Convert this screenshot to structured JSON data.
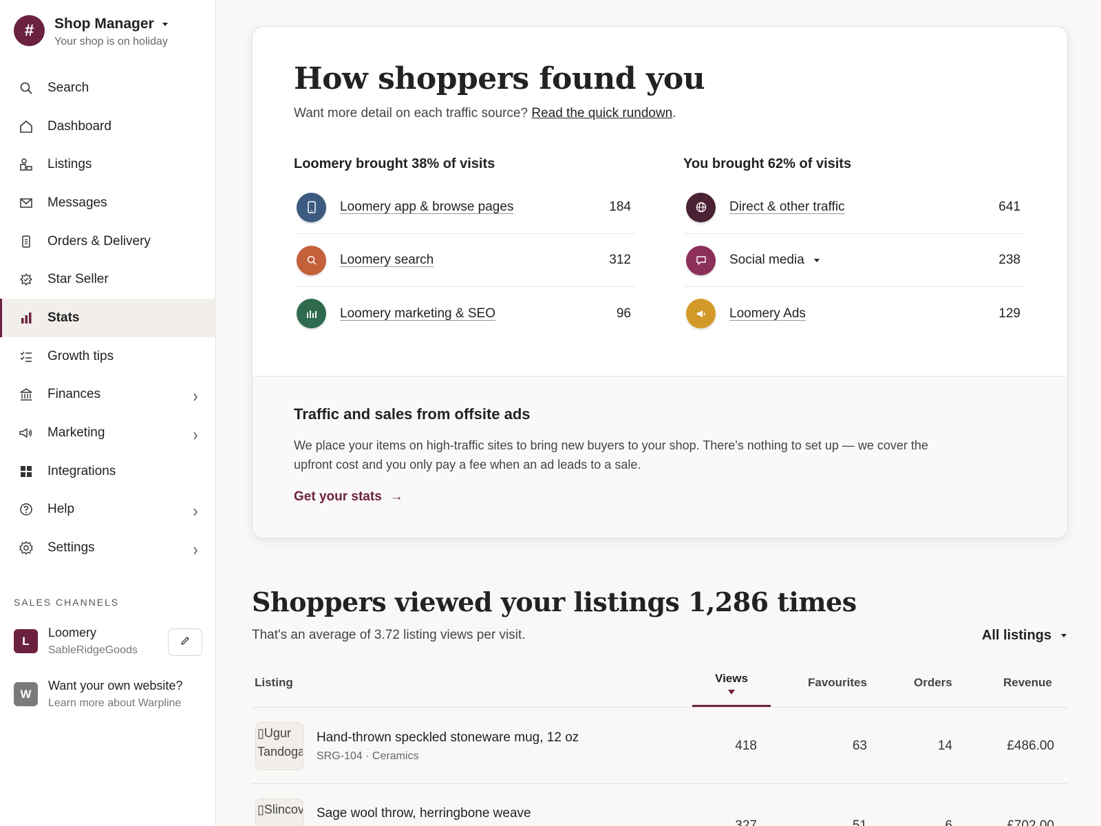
{
  "shop": {
    "logo_glyph": "#",
    "title": "Shop Manager",
    "status": "Your shop is on holiday"
  },
  "nav": [
    {
      "label": "Search",
      "icon": "search-icon"
    },
    {
      "label": "Dashboard",
      "icon": "home-icon"
    },
    {
      "label": "Listings",
      "icon": "listings-icon"
    },
    {
      "label": "Messages",
      "icon": "envelope-icon"
    },
    {
      "label": "Orders & Delivery",
      "icon": "clipboard-icon"
    },
    {
      "label": "Star Seller",
      "icon": "star-seller-icon"
    },
    {
      "label": "Stats",
      "icon": "bar-chart-icon",
      "active": true
    },
    {
      "label": "Growth tips",
      "icon": "checklist-icon"
    },
    {
      "label": "Finances",
      "icon": "bank-icon",
      "has_submenu": true
    },
    {
      "label": "Marketing",
      "icon": "megaphone-icon",
      "has_submenu": true
    },
    {
      "label": "Integrations",
      "icon": "grid-icon"
    },
    {
      "label": "Help",
      "icon": "help-icon",
      "has_submenu": true
    },
    {
      "label": "Settings",
      "icon": "gear-icon",
      "has_submenu": true
    }
  ],
  "sales_channels": {
    "header": "SALES CHANNELS",
    "channels": [
      {
        "badge": "L",
        "name": "Loomery",
        "sub": "SableRidgeGoods",
        "badge_color": "#6b2240"
      },
      {
        "badge": "W",
        "name": "Want your own website?",
        "sub": "Learn more about Warpline",
        "badge_color": "#7a7a7a"
      }
    ]
  },
  "traffic": {
    "title": "How shoppers found you",
    "subtitle_text": "Want more detail on each traffic source?",
    "subtitle_link": "Read the quick rundown",
    "subtitle_end": ".",
    "loomery_column": {
      "heading": "Loomery brought 38% of visits",
      "sources": [
        {
          "label": "Loomery app & browse pages",
          "value": "184",
          "icon": "phone-icon",
          "color": "#3d5a80"
        },
        {
          "label": "Loomery search",
          "value": "312",
          "icon": "search-icon",
          "color": "#c4603a"
        },
        {
          "label": "Loomery marketing & SEO",
          "value": "96",
          "icon": "bar-chart-icon",
          "color": "#2e6b4e"
        }
      ]
    },
    "you_column": {
      "heading": "You brought 62% of visits",
      "sources": [
        {
          "label": "Direct & other traffic",
          "value": "641",
          "icon": "globe-icon",
          "color": "#4a2233"
        },
        {
          "label": "Social media",
          "value": "238",
          "icon": "chat-bubble-icon",
          "color": "#8c2f5a",
          "dropdown": true
        },
        {
          "label": "Loomery Ads",
          "value": "129",
          "icon": "megaphone-icon",
          "color": "#d39a2a"
        }
      ]
    }
  },
  "offsite": {
    "title": "Traffic and sales from offsite ads",
    "text": "We place your items on high-traffic sites to bring new buyers to your shop. There's nothing to set up — we cover the upfront cost and you only pay a fee when an ad leads to a sale.",
    "link": "Get your stats",
    "link_arrow": "→"
  },
  "listing_views": {
    "title": "Shoppers viewed your listings 1,286 times",
    "subtitle": "That's an average of 3.72 listing views per visit.",
    "filter": "All listings",
    "columns": {
      "listing": "Listing",
      "views": "Views",
      "favourites": "Favourites",
      "orders": "Orders",
      "revenue": "Revenue"
    },
    "rows": [
      {
        "thumb_alt": "Ugur Tandogan",
        "title": "Hand-thrown speckled stoneware mug, 12 oz",
        "sub": "SRG-104 · Ceramics",
        "views": "418",
        "favourites": "63",
        "orders": "14",
        "revenue": "£486.00"
      },
      {
        "thumb_alt": "Slincove",
        "title": "Sage wool throw, herringbone weave",
        "sub": "",
        "views": "327",
        "favourites": "51",
        "orders": "6",
        "revenue": "£702.00"
      }
    ]
  }
}
